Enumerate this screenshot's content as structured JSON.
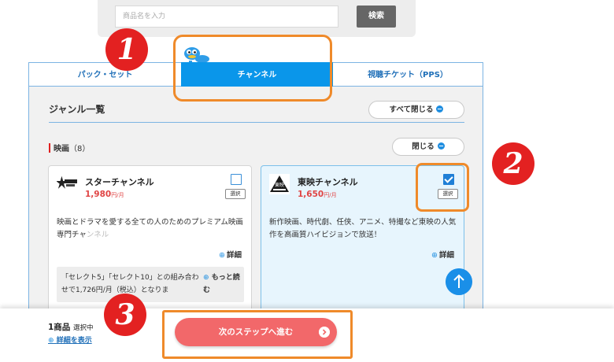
{
  "search": {
    "placeholder": "商品名を入力",
    "button_label": "検索"
  },
  "tabs": [
    {
      "label": "パック・セット",
      "active": false
    },
    {
      "label": "チャンネル",
      "active": true
    },
    {
      "label": "視聴チケット（PPS）",
      "active": false
    }
  ],
  "genre": {
    "title": "ジャンル一覧",
    "close_all_label": "すべて閉じる"
  },
  "category": {
    "name": "映画",
    "count": "（8）",
    "close_label": "閉じる"
  },
  "cards": [
    {
      "logo": "star-channel-logo",
      "name": "スターチャンネル",
      "price": "1,980",
      "price_unit": "円/月",
      "checked": false,
      "select_label": "選択",
      "description": "映画とドラマを愛する全ての人のためのプレミアム映画専門チャンネル",
      "detail_label": "詳細",
      "note": "「セレクト5」「セレクト10」との組み合わせで1,726円/月（税込）となりま",
      "read_more_label": "もっと読む"
    },
    {
      "logo": "toei-channel-logo",
      "name": "東映チャンネル",
      "price": "1,650",
      "price_unit": "円/月",
      "checked": true,
      "select_label": "選択",
      "description": "新作映画、時代劇、任侠、アニメ、特撮など東映の人気作を高画質ハイビジョンで放送！",
      "detail_label": "詳細"
    }
  ],
  "bottom": {
    "count": "1商品",
    "count_suffix": "選択中",
    "show_detail_label": "詳細を表示",
    "next_label": "次のステップへ進む"
  },
  "annotations": [
    "1",
    "2",
    "3"
  ],
  "colors": {
    "accent_blue": "#0a96ea",
    "price_red": "#e04545",
    "next_button": "#f2686a",
    "annotation_orange": "#ef8a2a",
    "badge_red": "#e32121"
  }
}
